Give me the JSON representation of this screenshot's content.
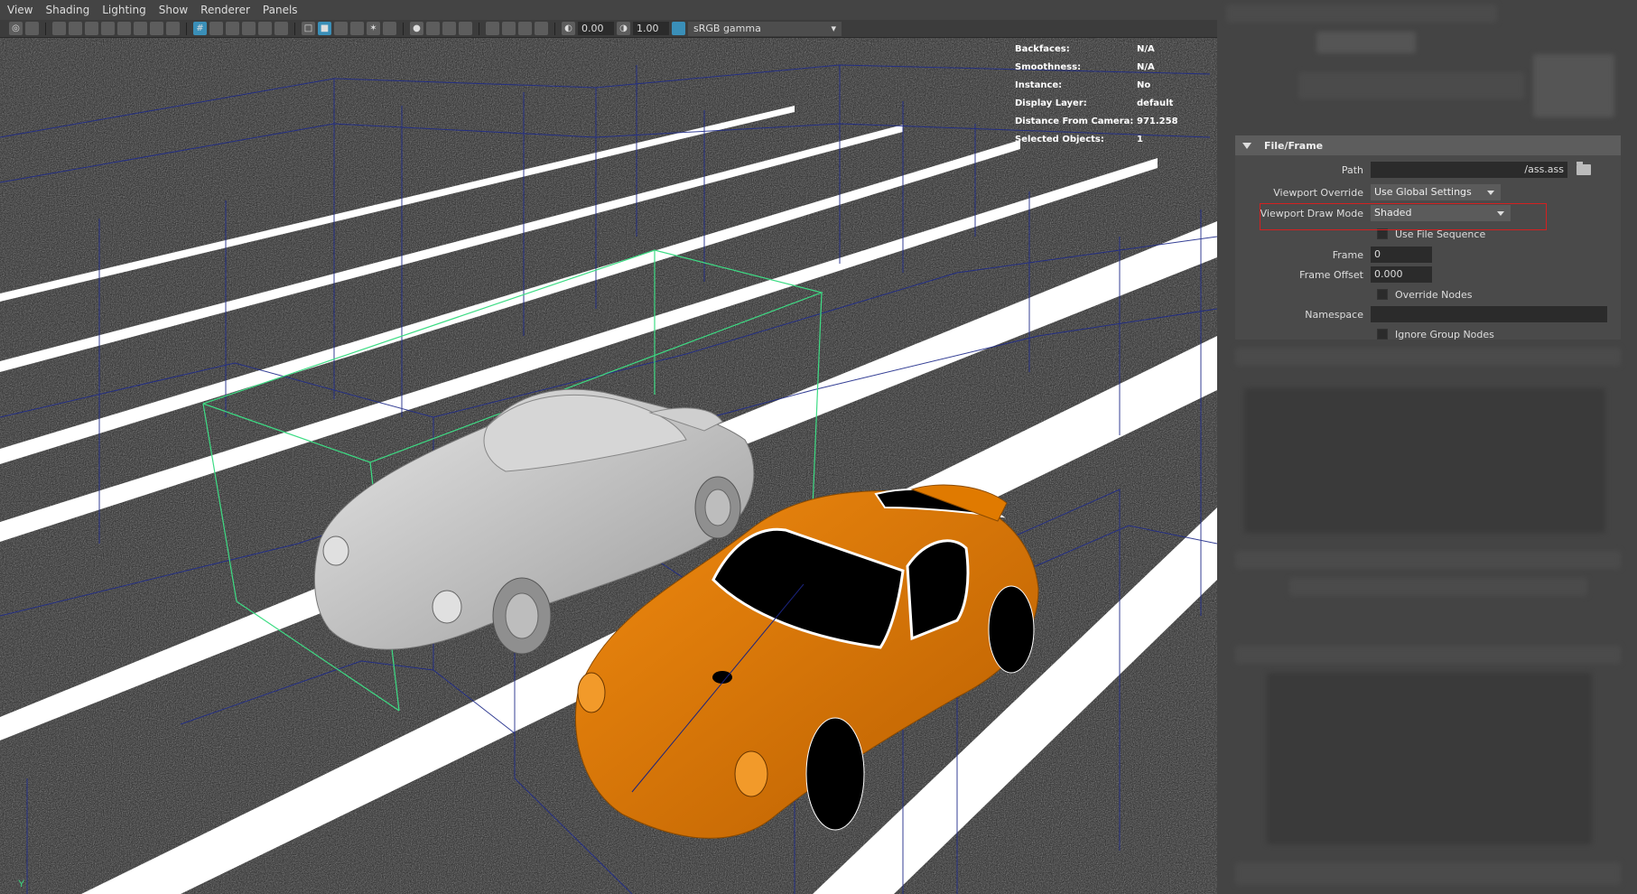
{
  "menubar": {
    "items": [
      "View",
      "Shading",
      "Lighting",
      "Show",
      "Renderer",
      "Panels"
    ]
  },
  "toolbar": {
    "exposure_value": "0.00",
    "gamma_value": "1.00",
    "color_space": "sRGB gamma"
  },
  "hud": {
    "rows": [
      {
        "label": "Backfaces:",
        "value": "N/A"
      },
      {
        "label": "Smoothness:",
        "value": "N/A"
      },
      {
        "label": "Instance:",
        "value": "No"
      },
      {
        "label": "Display Layer:",
        "value": "default"
      },
      {
        "label": "Distance From Camera:",
        "value": "971.258"
      },
      {
        "label": "Selected Objects:",
        "value": "1"
      }
    ]
  },
  "viewport": {
    "axis_label": "Y",
    "colors": {
      "road": "#262626",
      "stripe": "#ffffff",
      "bbox_blue": "#1a237e",
      "bbox_selected": "#3ddc84",
      "car_orange": "#e07a00",
      "car_gray": "#c8c8c8"
    }
  },
  "attribute_editor": {
    "section_title": "File/Frame",
    "path_label": "Path",
    "path_value": "/ass.ass",
    "viewport_override_label": "Viewport Override",
    "viewport_override_value": "Use Global Settings",
    "draw_mode_label": "Viewport Draw Mode",
    "draw_mode_value": "Shaded",
    "use_file_sequence_label": "Use File Sequence",
    "frame_label": "Frame",
    "frame_value": "0",
    "frame_offset_label": "Frame Offset",
    "frame_offset_value": "0.000",
    "override_nodes_label": "Override Nodes",
    "namespace_label": "Namespace",
    "namespace_value": "",
    "ignore_group_nodes_label": "Ignore Group Nodes"
  }
}
